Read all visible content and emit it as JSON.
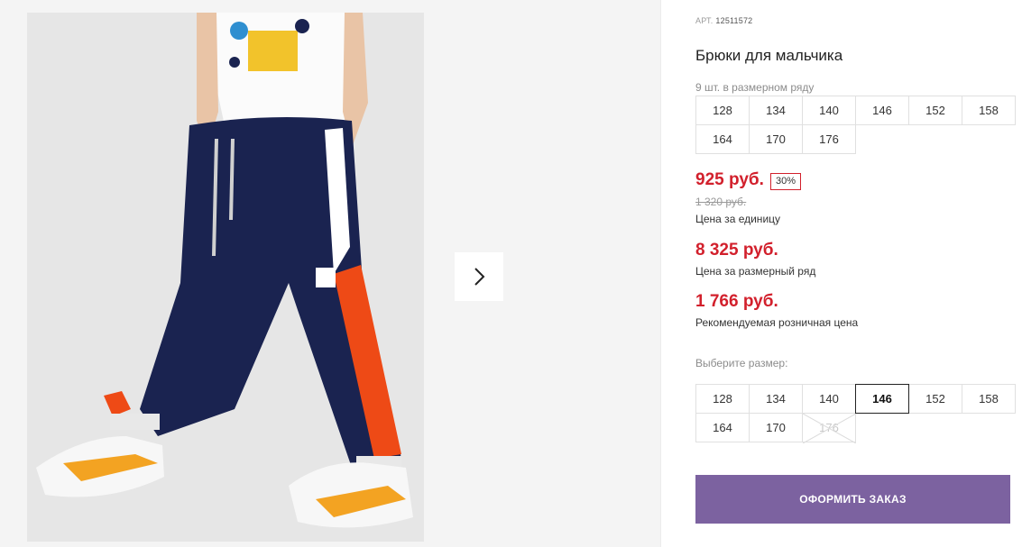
{
  "product": {
    "sku_label": "АРТ.",
    "sku": "12511572",
    "title": "Брюки для мальчика",
    "range_count": "9 шт. в размерном ряду",
    "range_sizes": [
      "128",
      "134",
      "140",
      "146",
      "152",
      "158",
      "164",
      "170",
      "176"
    ]
  },
  "prices": {
    "unit_price": "925 руб.",
    "discount": "30%",
    "old_price": "1 320 руб.",
    "unit_label": "Цена за единицу",
    "range_price": "8 325 руб.",
    "range_label": "Цена за размерный ряд",
    "rrp_price": "1 766 руб.",
    "rrp_label": "Рекомендуемая розничная цена"
  },
  "size_selector": {
    "label": "Выберите размер:",
    "sizes": [
      "128",
      "134",
      "140",
      "146",
      "152",
      "158",
      "164",
      "170",
      "176"
    ],
    "selected": "146",
    "unavailable": [
      "176"
    ]
  },
  "order_button": "ОФОРМИТЬ ЗАКАЗ",
  "gallery": {
    "next_icon": "chevron-right-icon"
  },
  "colors": {
    "price": "#d2202c",
    "accent_button": "#7c62a0"
  }
}
